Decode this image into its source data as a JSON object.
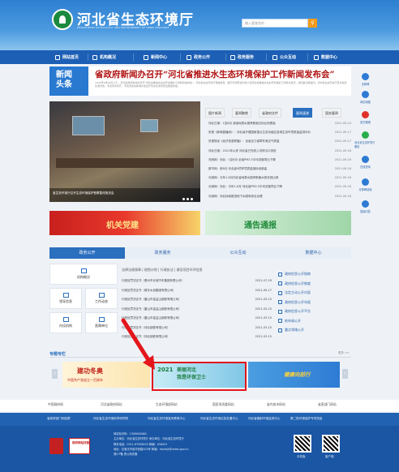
{
  "header": {
    "site_title": "河北省生态环境厅",
    "site_en": "DEPARTMENT OF ECOLOGY AND ENVIRONMENT OF HEBEI PROVINCE",
    "search_placeholder": "输入要查找的",
    "search_btn": "⚲"
  },
  "nav": [
    "网站首页",
    "机构概况",
    "新闻中心",
    "政务公开",
    "政务服务",
    "公众互动",
    "数据中心"
  ],
  "headline": {
    "tag_line1": "新闻",
    "tag_line2": "头条",
    "title": "省政府新闻办召开“河北省推进水生态环境保护工作新闻发布会”",
    "sub": "2021年9月28日上午，河北省政府新闻办召开“河北省推进水生态环境保护工作新闻发布会”，河北省生态环境厅党组成员、副厅长郭晓洁同志介绍河北省推进水生态环境保护工作有关情况，并回答记者提问。河北省生态环境厅有关处室负责同志，河北省水利厅、河北省住房和城乡建设厅有关负责同志出席发布会。"
  },
  "rail": [
    "无障碍",
    "网站地图",
    "官方微博",
    "河北省生态环境厅微信",
    "在线咨询",
    "无障碍阅读",
    "智能问答"
  ],
  "photo_caption": "省生态环境厅召开生态环境保护督察整改推进会",
  "tabs": [
    "图片新闻",
    "要闻聚焦",
    "省政府文件",
    "要闻速递",
    "国务要闻"
  ],
  "tab_active": 3,
  "news": [
    {
      "t": "河北日报：1至8月 我省地表水国考断面达标比例提高",
      "d": "2021-09-24"
    },
    {
      "t": "央视《新闻直播间》：河北省开展国家重点生态功能区县域生态环境质量监测评价",
      "d": "2021-09-17"
    },
    {
      "t": "央视财经《经济信息联播》：全省全力保障冬奥空气质量",
      "d": "2021-09-17"
    },
    {
      "t": "河北日报：2021年以来 河北省已完成入河排污口排查",
      "d": "2021-09-16"
    },
    {
      "t": "光明网：河北：1至8月 全省PM2.5平均浓度同比下降",
      "d": "2021-09-16"
    },
    {
      "t": "新华网：前8月 河北省9项环境质量指标创新高",
      "d": "2021-09-16"
    },
    {
      "t": "长城网：今年1-8月河北省地表水国考断面水质优良比例",
      "d": "2021-09-16"
    },
    {
      "t": "长城网：河北：今年1-8月 河北省PM2.5平均浓度同比下降",
      "d": "2021-09-16"
    },
    {
      "t": "长城网：河北持续推进地下水超采综合治理",
      "d": "2021-09-16"
    }
  ],
  "banners": {
    "b1": "机关党建",
    "b2": "通告通报"
  },
  "svc_tabs": [
    "政务公开",
    "政务服务",
    "公众互动",
    "数据中心"
  ],
  "gov_grid": [
    "机构概况",
    "领导信息",
    "工作动态",
    "内设机构",
    "直属单位"
  ],
  "sub_tabs": "法律法规规章  |  规划计划  |  行政执法  |  建设项目环评信息",
  "pub": [
    {
      "t": "行政处罚决定书（晋州市长城汽车集团有限公司）",
      "d": "2021-07-29"
    },
    {
      "t": "行政处罚决定书（冀东水泥集团有限公司）",
      "d": "2021-05-17"
    },
    {
      "t": "行政处罚决定书（唐山市金益山钢铁有限公司）",
      "d": "2021-03-15"
    },
    {
      "t": "行政处罚决定书（唐山市金益山钢铁有限公司）",
      "d": "2021-03-15"
    },
    {
      "t": "行政处罚决定书（唐山市金益山钢铁有限公司）",
      "d": "2021-03-15"
    },
    {
      "t": "行政处罚决定书（河北钢铁有限公司）",
      "d": "2021-03-15"
    },
    {
      "t": "行政处罚决定书（河北钢铁有限公司）",
      "d": "2021-03-15"
    }
  ],
  "open_links": [
    "政府信息公开指南",
    "政府信息公开制度",
    "法定主动公开内容",
    "政府信息公开年报",
    "政府信息公开平台",
    "依申请公开",
    "重点领域公开"
  ],
  "topic": {
    "title": "专题专栏",
    "more": "更多 >>",
    "t1": "建功冬奥",
    "t1s": "中国共产党成立一百周年",
    "t2y": "2021",
    "t2": "美丽河北",
    "t2b": "我是环保卫士",
    "t3": "健康向前行"
  },
  "links": [
    "中国政府网",
    "河北省政府网站",
    "生态环境部网站",
    "国家发改委网站",
    "省内各市网站",
    "省直部门网站"
  ],
  "links2": [
    "省政府部门网站群",
    "河北省生态环境科学研究院",
    "河北省生态环境宣传教育中心",
    "河北省生态环境应急处置中心",
    "河北省辐射环境监测中心",
    "第二批环境保护专项资金"
  ],
  "footer": {
    "l1": "网站标识码：1300000064",
    "l2": "主办单位：河北省生态环境厅  承办单位：河北省生态环境厅",
    "l3": "联系电话：0311-87908203  邮编：050051",
    "l4": "地址：石家庄市裕华西路203号  邮箱：hbsthjt@hebei.gov.cn",
    "l5": "冀ICP备  冀公网安备",
    "logo2": "政府网站找错",
    "qr1": "手机版",
    "qr2": "客户端"
  }
}
